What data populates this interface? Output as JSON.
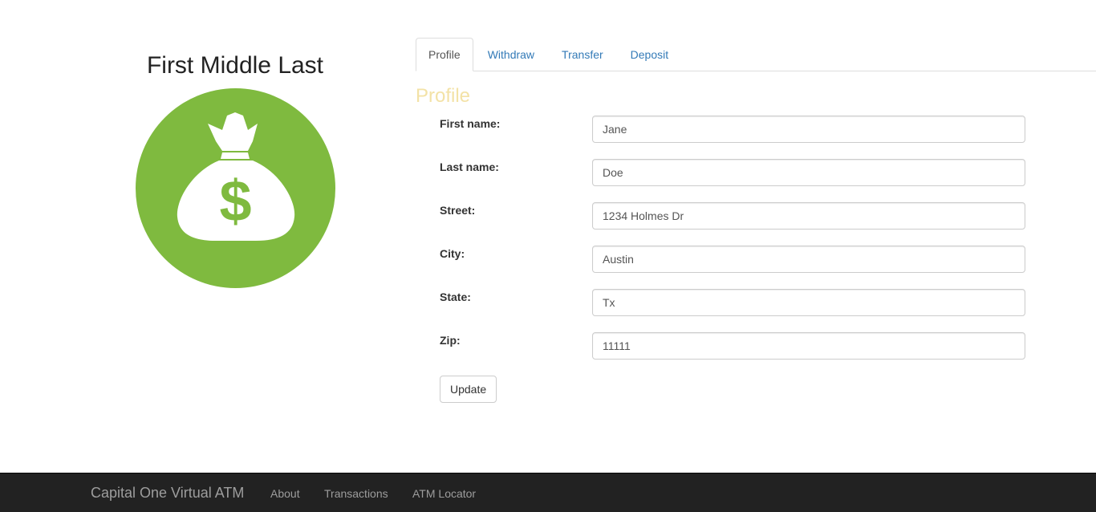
{
  "user": {
    "full_name": "First Middle Last"
  },
  "avatar": {
    "icon": "money-bag-icon",
    "circle_color": "#7fba3f",
    "bag_color": "#ffffff",
    "symbol": "$"
  },
  "tabs": [
    {
      "label": "Profile",
      "active": true
    },
    {
      "label": "Withdraw",
      "active": false
    },
    {
      "label": "Transfer",
      "active": false
    },
    {
      "label": "Deposit",
      "active": false
    }
  ],
  "profile": {
    "title": "Profile",
    "title_color": "#f3e2a6",
    "fields": [
      {
        "label": "First name:",
        "value": "Jane"
      },
      {
        "label": "Last name:",
        "value": "Doe"
      },
      {
        "label": "Street:",
        "value": "1234 Holmes Dr"
      },
      {
        "label": "City:",
        "value": "Austin"
      },
      {
        "label": "State:",
        "value": "Tx"
      },
      {
        "label": "Zip:",
        "value": "11111"
      }
    ],
    "update_label": "Update"
  },
  "navbar": {
    "brand": "Capital One Virtual ATM",
    "links": [
      "About",
      "Transactions",
      "ATM Locator"
    ]
  }
}
